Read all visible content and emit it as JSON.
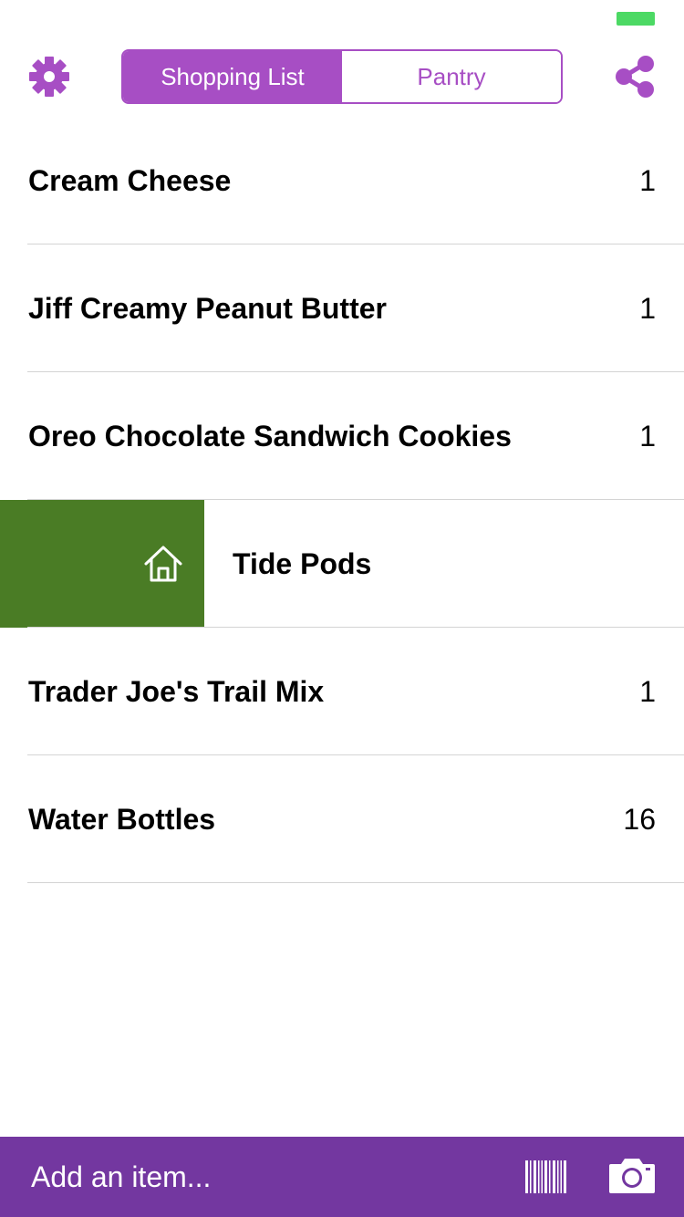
{
  "status_bar": {
    "battery_color": "#4cd964"
  },
  "nav": {
    "settings_icon": "gear-icon",
    "share_icon": "share-icon",
    "segments": [
      {
        "label": "Shopping List",
        "active": true
      },
      {
        "label": "Pantry",
        "active": false
      }
    ],
    "accent_color": "#a74ec4"
  },
  "list": {
    "items": [
      {
        "name": "Cream Cheese",
        "quantity": "1"
      },
      {
        "name": "Jiff Creamy Peanut Butter",
        "quantity": "1"
      },
      {
        "name": "Oreo Chocolate Sandwich Cookies",
        "quantity": "1"
      },
      {
        "name": "Tide Pods",
        "quantity": "",
        "swipe_action_icon": "house-icon",
        "swipe_action_color": "#4a7c25"
      },
      {
        "name": "Trader Joe's Trail Mix",
        "quantity": "1"
      },
      {
        "name": "Water Bottles",
        "quantity": "16"
      }
    ]
  },
  "bottom_bar": {
    "placeholder": "Add an item...",
    "barcode_icon": "barcode-icon",
    "camera_icon": "camera-icon",
    "background_color": "#7337a0"
  }
}
